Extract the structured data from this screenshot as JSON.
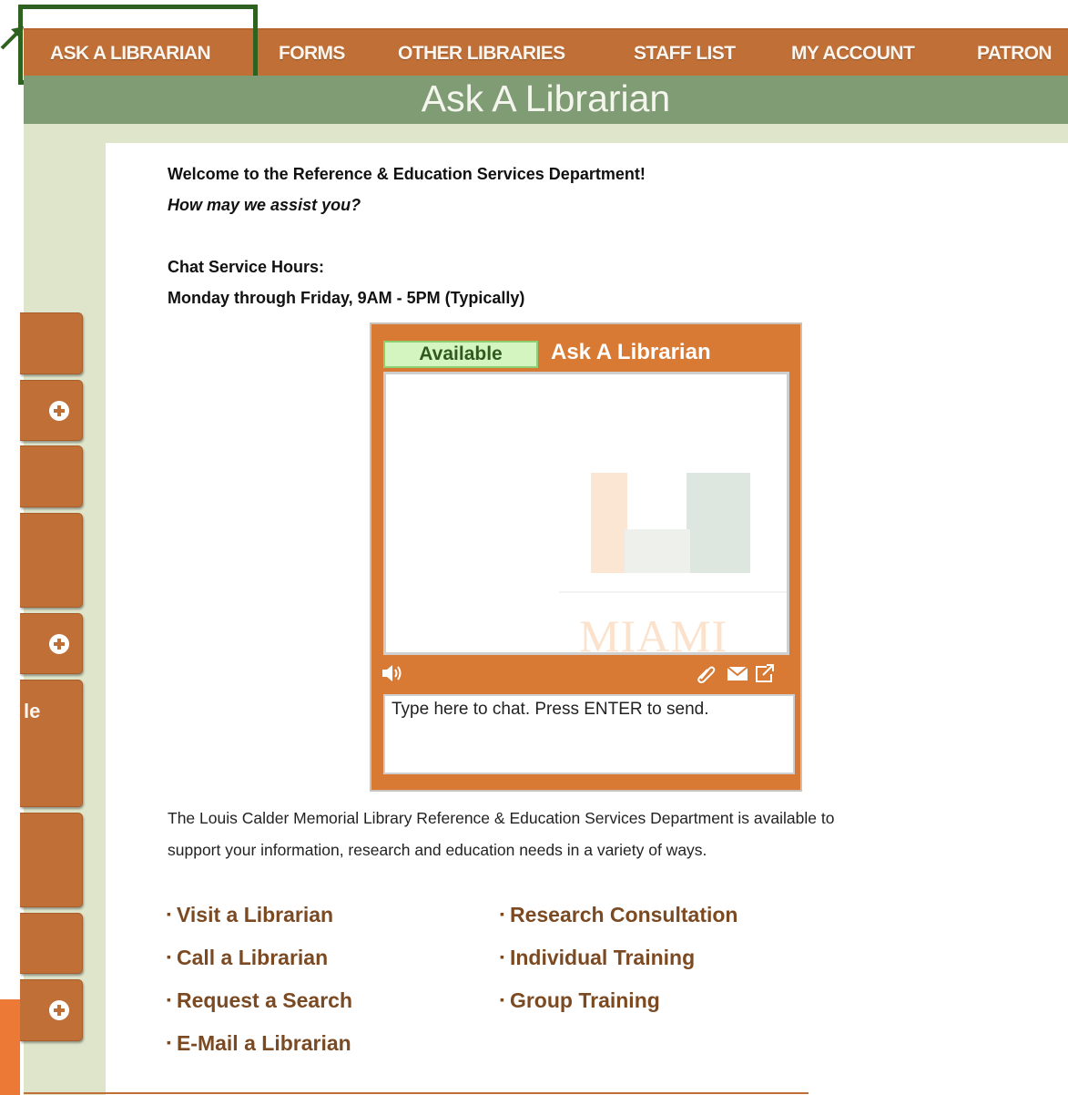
{
  "nav": {
    "items": [
      "ASK A LIBRARIAN",
      "FORMS",
      "OTHER LIBRARIES",
      "STAFF LIST",
      "MY ACCOUNT",
      "PATRON"
    ],
    "active": "ASK A LIBRARIAN"
  },
  "banner": {
    "title": "Ask A Librarian"
  },
  "sidebar": {
    "fragment_text": "le"
  },
  "content": {
    "welcome": "Welcome to the Reference & Education Services Department!",
    "assist": "How may we assist you?",
    "hours_label": "Chat Service Hours:",
    "hours_value": "Monday through Friday, 9AM - 5PM (Typically)",
    "description_line1": "The Louis Calder Memorial Library Reference & Education Services Department is available to",
    "description_line2": "support your information, research and education needs in a variety of ways."
  },
  "chat": {
    "status": "Available",
    "title": "Ask A Librarian",
    "logo_text": "MIAMI",
    "input_placeholder": "Type here to chat. Press ENTER to send.",
    "icons": [
      "speaker-icon",
      "paperclip-icon",
      "envelope-icon",
      "popout-icon"
    ]
  },
  "links": {
    "left": [
      "Visit a Librarian",
      "Call a Librarian",
      "Request a Search",
      "E-Mail a Librarian"
    ],
    "right": [
      "Research Consultation",
      "Individual Training",
      "Group Training"
    ]
  },
  "colors": {
    "nav": "#c06f36",
    "banner": "#7f9c75",
    "sidebar": "#dfe5cb",
    "chat": "#d87a33",
    "highlight": "#2f6121",
    "link": "#7b4a22"
  }
}
